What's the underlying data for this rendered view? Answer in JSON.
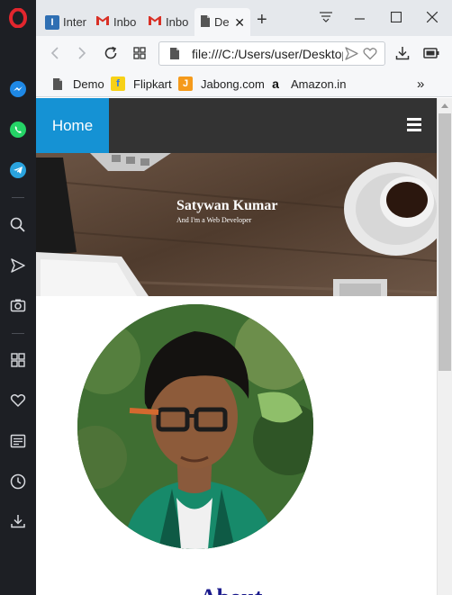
{
  "tabs": [
    {
      "label": "Inter",
      "icon": "is-icon",
      "active": false
    },
    {
      "label": "Inbo",
      "icon": "gmail-icon",
      "active": false
    },
    {
      "label": "Inbo",
      "icon": "gmail-icon",
      "active": false
    },
    {
      "label": "De",
      "icon": "document-icon",
      "active": true
    }
  ],
  "address_bar": {
    "url": "file:///C:/Users/user/Desktop"
  },
  "bookmarks": [
    {
      "label": "Demo",
      "icon": "document-icon"
    },
    {
      "label": "Flipkart",
      "icon": "flipkart-icon"
    },
    {
      "label": "Jabong.com",
      "icon": "jabong-icon"
    },
    {
      "label": "Amazon.in",
      "icon": "amazon-icon"
    }
  ],
  "page": {
    "nav": {
      "home_label": "Home"
    },
    "hero": {
      "name": "Satywan Kumar",
      "tagline": "And I'm a Web Developer"
    },
    "about_heading": "About"
  },
  "colors": {
    "sidebar_bg": "#1d1f24",
    "opera_red": "#e3262e",
    "nav_bg": "#333333",
    "home_bg": "#1592d4",
    "heading": "#1a1a8c"
  }
}
